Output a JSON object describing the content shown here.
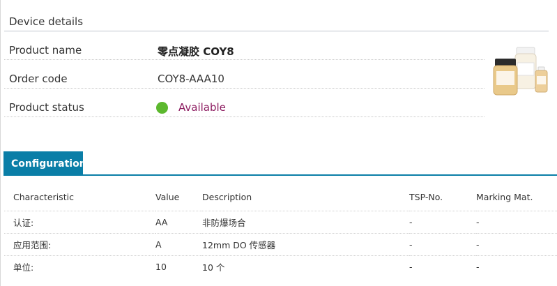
{
  "device_details": {
    "title": "Device details",
    "rows": [
      {
        "label": "Product name",
        "value": "零点凝胶 COY8"
      },
      {
        "label": "Order code",
        "value": "COY8-AAA10"
      },
      {
        "label": "Product status",
        "value": "Available"
      }
    ],
    "status_color": "#5cb82e",
    "status_text_color": "#8c1a5f"
  },
  "configuration": {
    "tab_label": "Configuration",
    "accent": "#0a7ea7",
    "headers": [
      "Characteristic",
      "Value",
      "Description",
      "TSP-No.",
      "Marking Mat."
    ],
    "rows": [
      [
        "认证:",
        "AA",
        "非防爆场合",
        "-",
        "-"
      ],
      [
        "应用范围:",
        "A",
        "12mm DO 传感器",
        "-",
        "-"
      ],
      [
        "单位:",
        "10",
        "10 个",
        "-",
        "-"
      ]
    ]
  }
}
